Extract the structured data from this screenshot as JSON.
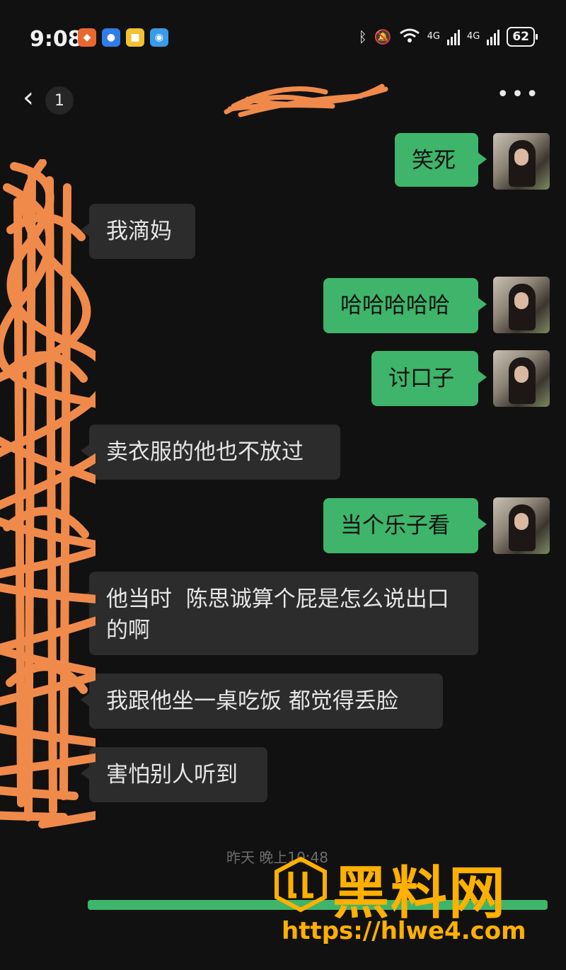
{
  "status_bar": {
    "time": "9:08",
    "network_1": "4G",
    "network_2": "4G",
    "battery": "62"
  },
  "header": {
    "back_icon": "chevron-left-icon",
    "unread_count": "1",
    "more_icon": "more-icon"
  },
  "messages": [
    {
      "side": "out",
      "text": "笑死"
    },
    {
      "side": "in",
      "text": "我滴妈"
    },
    {
      "side": "out",
      "text": "哈哈哈哈哈"
    },
    {
      "side": "out",
      "text": "讨口子"
    },
    {
      "side": "in",
      "text": "卖衣服的他也不放过"
    },
    {
      "side": "out",
      "text": "当个乐子看"
    },
    {
      "side": "in",
      "text": "他当时  陈思诚算个屁是怎么说出口的啊"
    },
    {
      "side": "in",
      "text": "我跟他坐一桌吃饭 都觉得丢脸"
    },
    {
      "side": "in",
      "text": "害怕别人听到"
    }
  ],
  "timestamp": "昨天 晚上10:48",
  "watermark": {
    "title": "黑料网",
    "url": "https://hlwe4.com"
  },
  "colors": {
    "background": "#111111",
    "outgoing_bubble": "#3eb56a",
    "incoming_bubble": "#2c2c2c",
    "scribble": "#f08a4b",
    "watermark": "#ffb000"
  }
}
